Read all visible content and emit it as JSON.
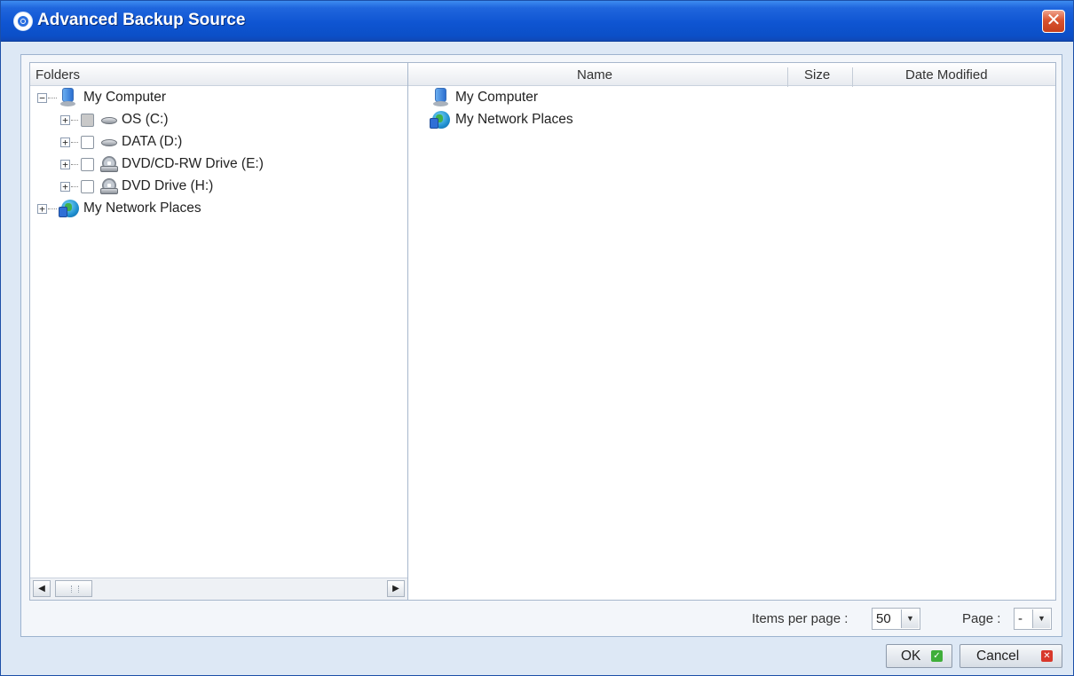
{
  "window": {
    "title": "Advanced Backup Source",
    "close_glyph": "✕",
    "icon": "app-target-icon"
  },
  "left_panel": {
    "header": "Folders",
    "tree": [
      {
        "label": "My Computer",
        "icon": "computer-icon",
        "expanded": true,
        "expander": "−"
      },
      {
        "label": "OS (C:)",
        "icon": "hard-disk-icon",
        "checkbox": "partial",
        "expander": "+"
      },
      {
        "label": "DATA (D:)",
        "icon": "hard-disk-icon",
        "checkbox": "unchecked",
        "expander": "+"
      },
      {
        "label": "DVD/CD-RW Drive (E:)",
        "icon": "dvd-drive-icon",
        "checkbox": "unchecked",
        "expander": "+"
      },
      {
        "label": "DVD Drive (H:)",
        "icon": "dvd-drive-icon",
        "checkbox": "unchecked",
        "expander": "+"
      },
      {
        "label": "My Network Places",
        "icon": "network-icon",
        "expander": "+"
      }
    ],
    "scroll_left": "◀",
    "scroll_right": "▶"
  },
  "right_panel": {
    "columns": {
      "name": "Name",
      "size": "Size",
      "date": "Date Modified"
    },
    "rows": [
      {
        "name": "My Computer",
        "icon": "computer-icon"
      },
      {
        "name": "My Network Places",
        "icon": "network-icon"
      }
    ]
  },
  "pagination": {
    "items_per_page_label": "Items per page :",
    "items_per_page_value": "50",
    "page_label": "Page :",
    "page_value": "-",
    "dropdown_glyph": "▼"
  },
  "buttons": {
    "ok": "OK",
    "ok_icon_glyph": "✓",
    "cancel": "Cancel",
    "cancel_icon_glyph": "✕"
  },
  "colors": {
    "titlebar": "#0f55d2",
    "panel_border": "#a7b7cc",
    "ok_icon": "#3fae3a",
    "cancel_icon": "#d8382b"
  }
}
